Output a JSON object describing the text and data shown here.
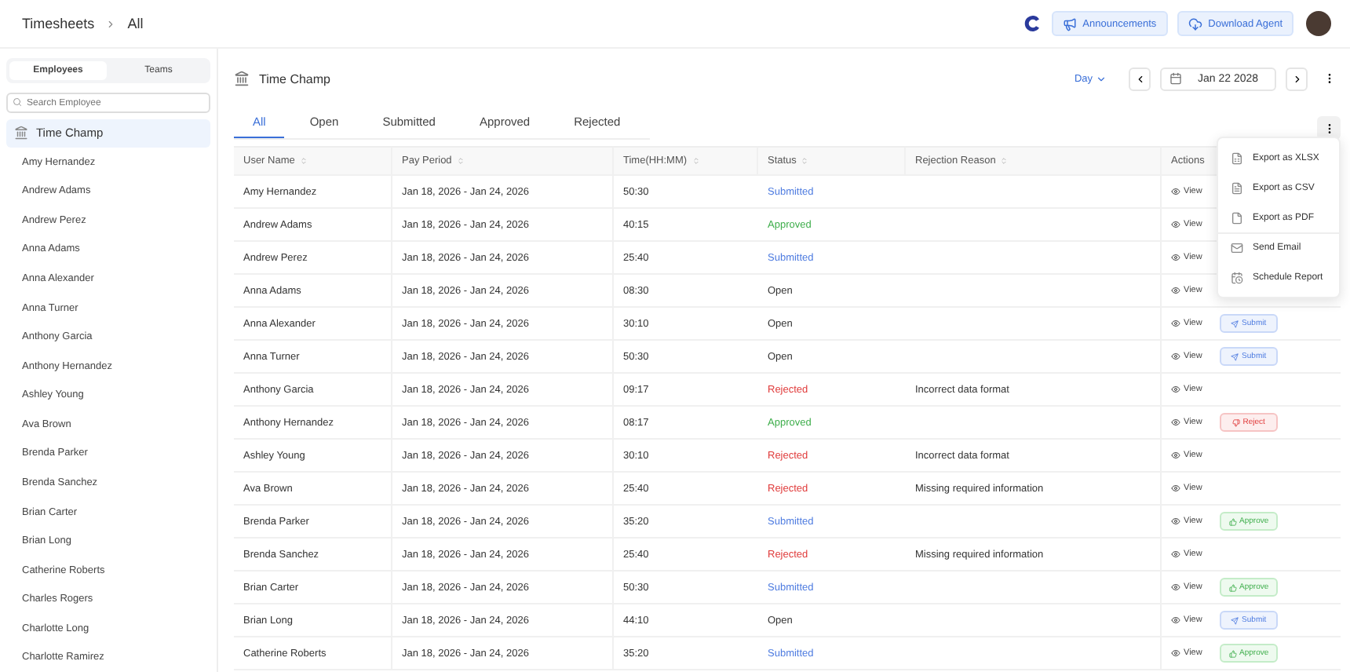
{
  "breadcrumb": [
    "Timesheets",
    "All"
  ],
  "header_buttons": [
    "Announcements",
    "Download Agent"
  ],
  "sidebar": {
    "tabs": [
      {
        "label": "Employees",
        "selected": true
      },
      {
        "label": "Teams",
        "selected": false
      }
    ],
    "search": {
      "placeholder": "Search Employee"
    },
    "org": {
      "label": "Time Champ",
      "selected": true
    },
    "items": [
      "Amy Hernandez",
      "Andrew Adams",
      "Andrew Perez",
      "Anna Adams",
      "Anna Alexander",
      "Anna Turner",
      "Anthony Garcia",
      "Anthony Hernandez",
      "Ashley Young",
      "Ava Brown",
      "Brenda Parker",
      "Brenda Sanchez",
      "Brian Carter",
      "Brian Long",
      "Catherine Roberts",
      "Charles Rogers",
      "Charlotte Long",
      "Charlotte Ramirez"
    ]
  },
  "title": "Time Champ",
  "period": {
    "label": "Day",
    "date": "Jan 22 2028"
  },
  "tabs": [
    {
      "label": "All",
      "selected": true
    },
    {
      "label": "Open",
      "selected": false
    },
    {
      "label": "Submitted",
      "selected": false
    },
    {
      "label": "Approved",
      "selected": false
    },
    {
      "label": "Rejected",
      "selected": false
    }
  ],
  "table": {
    "columns": [
      {
        "label": "User Name",
        "sortable": true
      },
      {
        "label": "Pay Period",
        "sortable": true
      },
      {
        "label": "Time(HH:MM)",
        "sortable": true
      },
      {
        "label": "Status",
        "sortable": true
      },
      {
        "label": "Rejection Reason",
        "sortable": true
      },
      {
        "label": "Actions",
        "sortable": false
      }
    ],
    "rows": [
      {
        "user": "Amy Hernandez",
        "period": "Jan 18, 2026 - Jan 24, 2026",
        "time": "50:30",
        "status": {
          "label": "Submitted",
          "color": "#4d7be0"
        },
        "view": "View"
      },
      {
        "user": "Andrew Adams",
        "period": "Jan 18, 2026 - Jan 24, 2026",
        "time": "40:15",
        "status": {
          "label": "Approved",
          "color": "#3fae4c"
        },
        "view": "View"
      },
      {
        "user": "Andrew Perez",
        "period": "Jan 18, 2026 - Jan 24, 2026",
        "time": "25:40",
        "status": {
          "label": "Submitted",
          "color": "#4d7be0"
        },
        "view": "View"
      },
      {
        "user": "Anna Adams",
        "period": "Jan 18, 2026 - Jan 24, 2026",
        "time": "08:30",
        "status": {
          "label": "Open",
          "color": "#333333"
        },
        "view": "View"
      },
      {
        "user": "Anna Alexander",
        "period": "Jan 18, 2026 - Jan 24, 2026",
        "time": "30:10",
        "status": {
          "label": "Open",
          "color": "#333333"
        },
        "view": "View",
        "action": {
          "kind": "submit",
          "label": "Submit"
        }
      },
      {
        "user": "Anna Turner",
        "period": "Jan 18, 2026 - Jan 24, 2026",
        "time": "50:30",
        "status": {
          "label": "Open",
          "color": "#333333"
        },
        "view": "View",
        "action": {
          "kind": "submit",
          "label": "Submit"
        }
      },
      {
        "user": "Anthony Garcia",
        "period": "Jan 18, 2026 - Jan 24, 2026",
        "time": "09:17",
        "status": {
          "label": "Rejected",
          "color": "#e03a3a"
        },
        "reason": "Incorrect data format",
        "view": "View"
      },
      {
        "user": "Anthony Hernandez",
        "period": "Jan 18, 2026 - Jan 24, 2026",
        "time": "08:17",
        "status": {
          "label": "Approved",
          "color": "#3fae4c"
        },
        "view": "View",
        "action": {
          "kind": "reject",
          "label": "Reject"
        }
      },
      {
        "user": "Ashley Young",
        "period": "Jan 18, 2026 - Jan 24, 2026",
        "time": "30:10",
        "status": {
          "label": "Rejected",
          "color": "#e03a3a"
        },
        "reason": "Incorrect data format",
        "view": "View"
      },
      {
        "user": "Ava Brown",
        "period": "Jan 18, 2026 - Jan 24, 2026",
        "time": "25:40",
        "status": {
          "label": "Rejected",
          "color": "#e03a3a"
        },
        "reason": "Missing required information",
        "view": "View"
      },
      {
        "user": "Brenda Parker",
        "period": "Jan 18, 2026 - Jan 24, 2026",
        "time": "35:20",
        "status": {
          "label": "Submitted",
          "color": "#4d7be0"
        },
        "view": "View",
        "action": {
          "kind": "approve",
          "label": "Approve"
        }
      },
      {
        "user": "Brenda Sanchez",
        "period": "Jan 18, 2026 - Jan 24, 2026",
        "time": "25:40",
        "status": {
          "label": "Rejected",
          "color": "#e03a3a"
        },
        "reason": "Missing required information",
        "view": "View"
      },
      {
        "user": "Brian Carter",
        "period": "Jan 18, 2026 - Jan 24, 2026",
        "time": "50:30",
        "status": {
          "label": "Submitted",
          "color": "#4d7be0"
        },
        "view": "View",
        "action": {
          "kind": "approve",
          "label": "Approve"
        }
      },
      {
        "user": "Brian Long",
        "period": "Jan 18, 2026 - Jan 24, 2026",
        "time": "44:10",
        "status": {
          "label": "Open",
          "color": "#333333"
        },
        "view": "View",
        "action": {
          "kind": "submit",
          "label": "Submit"
        }
      },
      {
        "user": "Catherine Roberts",
        "period": "Jan 18, 2026 - Jan 24, 2026",
        "time": "35:20",
        "status": {
          "label": "Submitted",
          "color": "#4d7be0"
        },
        "view": "View",
        "action": {
          "kind": "approve",
          "label": "Approve"
        }
      }
    ]
  },
  "menu": {
    "items": [
      {
        "label": "Export as XLSX",
        "kind": "xlsx"
      },
      {
        "label": "Export as CSV",
        "kind": "csv"
      },
      {
        "label": "Export as PDF",
        "kind": "pdf"
      },
      {
        "label": "Send Email",
        "kind": "email"
      },
      {
        "label": "Schedule Report",
        "kind": "schedule"
      }
    ]
  }
}
